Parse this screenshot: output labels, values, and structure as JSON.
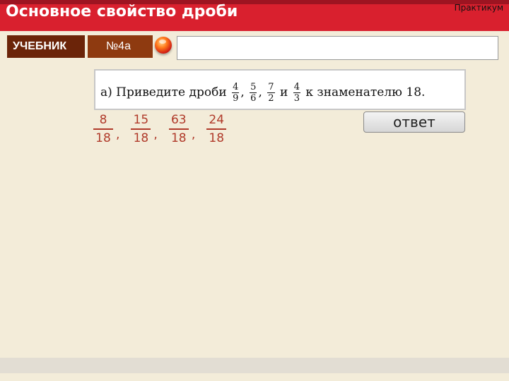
{
  "header": {
    "title": "Основное свойство дроби"
  },
  "tabs": {
    "textbook": "УЧЕБНИК",
    "number": "№4а"
  },
  "task": {
    "prefix": "а) Приведите дроби",
    "fractions": [
      {
        "n": "4",
        "d": "9"
      },
      {
        "n": "5",
        "d": "6"
      },
      {
        "n": "7",
        "d": "2"
      },
      {
        "n": "4",
        "d": "3"
      }
    ],
    "sep1": ",",
    "sep2": ",",
    "conj": "и",
    "suffix": "к знаменателю 18."
  },
  "answers": [
    {
      "n": "8",
      "d": "18"
    },
    {
      "n": "15",
      "d": "18"
    },
    {
      "n": "63",
      "d": "18"
    },
    {
      "n": "24",
      "d": "18"
    }
  ],
  "answer_separator": ",",
  "answer_button": "ответ",
  "footer": {
    "label": "Практикум"
  },
  "colors": {
    "header": "#d9202e",
    "tab": "#6b2409",
    "answer": "#b03a2a"
  },
  "icons": {
    "orb": "red-orb-button"
  }
}
